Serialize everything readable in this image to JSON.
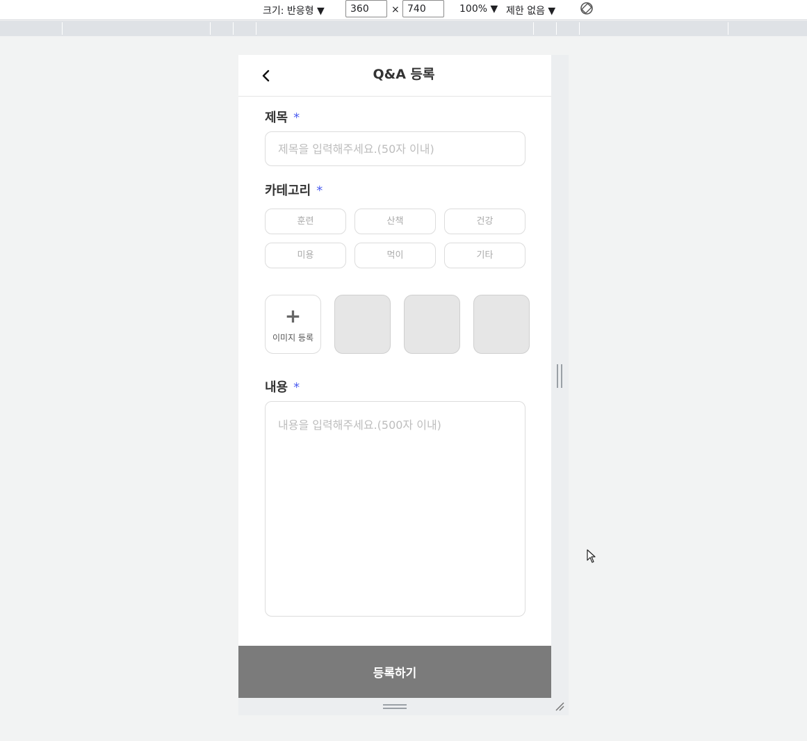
{
  "devtools": {
    "size_label": "크기: 반응형 ▼",
    "width": "360",
    "times": "×",
    "height": "740",
    "zoom": "100% ▼",
    "throttle": "제한 없음 ▼",
    "rotate_icon": "rotate-icon"
  },
  "header": {
    "back_icon": "chevron-left-icon",
    "title": "Q&A 등록"
  },
  "form": {
    "title_label": "제목",
    "required_mark": "*",
    "title_placeholder": "제목을 입력해주세요.(50자 이내)",
    "category_label": "카테고리",
    "categories": [
      "훈련",
      "산책",
      "건강",
      "미용",
      "먹이",
      "기타"
    ],
    "image_add_label": "이미지 등록",
    "image_add_icon": "plus-icon",
    "content_label": "내용",
    "content_placeholder": "내용을 입력해주세요.(500자 이내)",
    "submit_label": "등록하기"
  },
  "colors": {
    "required": "#4a5cf0",
    "submit_bg": "#7b7b7b",
    "border": "#dcdcdc",
    "placeholder": "#bdbdbd"
  }
}
